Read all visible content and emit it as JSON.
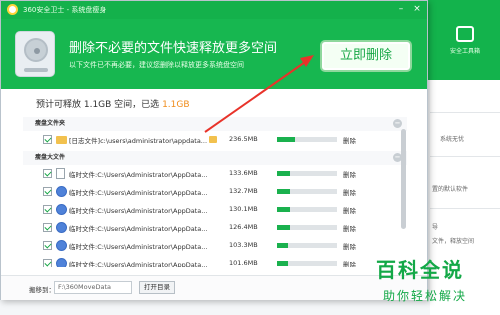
{
  "window": {
    "title": "360安全卫士 - 系统盘瘦身",
    "minimize_glyph": "–",
    "close_glyph": "×"
  },
  "banner": {
    "title": "删除不必要的文件快速释放更多空间",
    "subtitle": "以下文件已不再必要，建议您删除以释放更多系统盘空间",
    "delete_button": "立即删除"
  },
  "summary": {
    "prefix": "预计可释放 1.1GB 空间，已选",
    "selected": "1.1GB"
  },
  "groups": [
    {
      "label": "瘦盘文件夹",
      "rows": [
        {
          "path": "[日志文件]c:\\users\\administrator\\appdata...",
          "size": "236.5MB",
          "progress": 0.3,
          "action": "删除",
          "icon": "folder-icon"
        }
      ]
    },
    {
      "label": "瘦盘大文件",
      "rows": [
        {
          "path": "临时文件:C:\\Users\\Administrator\\AppData...",
          "size": "133.6MB",
          "progress": 0.22,
          "action": "删除",
          "icon": "file-icon"
        },
        {
          "path": "临时文件:C:\\Users\\Administrator\\AppData...",
          "size": "132.7MB",
          "progress": 0.22,
          "action": "删除",
          "icon": "temp-file-icon"
        },
        {
          "path": "临时文件:C:\\Users\\Administrator\\AppData...",
          "size": "130.1MB",
          "progress": 0.22,
          "action": "删除",
          "icon": "temp-file-icon"
        },
        {
          "path": "临时文件:C:\\Users\\Administrator\\AppData...",
          "size": "126.4MB",
          "progress": 0.22,
          "action": "删除",
          "icon": "temp-file-icon"
        },
        {
          "path": "临时文件:C:\\Users\\Administrator\\AppData...",
          "size": "103.3MB",
          "progress": 0.18,
          "action": "删除",
          "icon": "temp-file-icon"
        },
        {
          "path": "临时文件:C:\\Users\\Administrator\\AppData...",
          "size": "101.6MB",
          "progress": 0.18,
          "action": "删除",
          "icon": "temp-file-icon"
        }
      ]
    }
  ],
  "footer": {
    "move_label": "搬移到：",
    "move_path": "F:\\360MoveData",
    "open_dir_button": "打开目录"
  },
  "background": {
    "tool_label": "安全工具箱",
    "texts": [
      "系统无忧",
      "置的默认软件",
      "文件，释放空间",
      "导"
    ]
  },
  "watermark": {
    "brand": "百科全说",
    "tagline": "助你轻松解决"
  },
  "colors": {
    "brand_green": "#17b750",
    "accent_orange": "#f08c1a"
  }
}
